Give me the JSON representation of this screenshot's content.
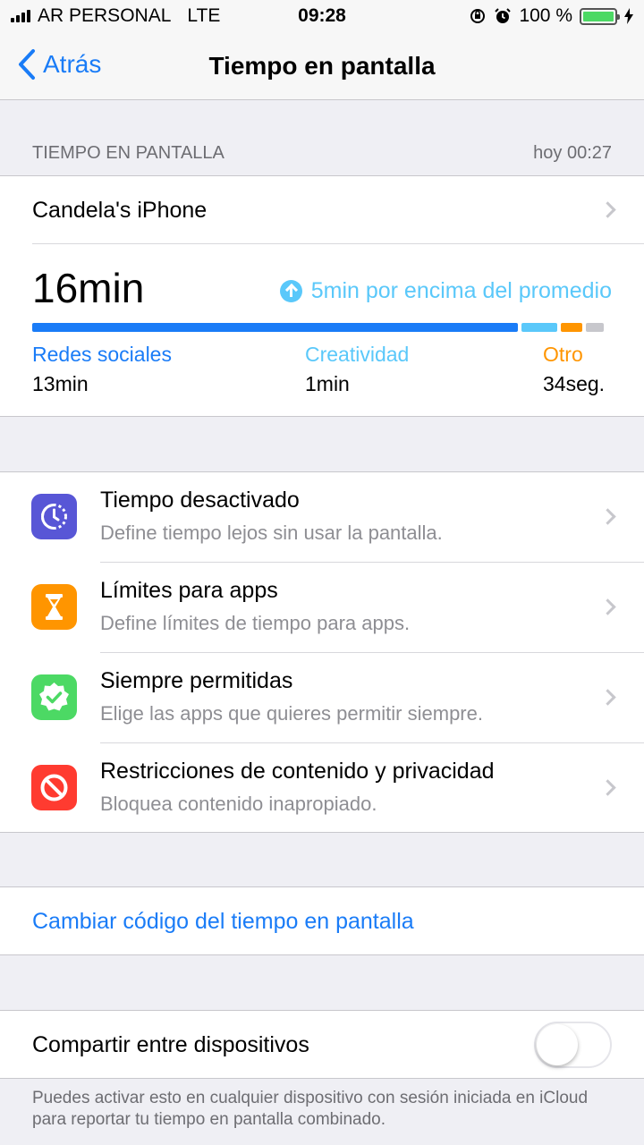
{
  "status_bar": {
    "carrier": "AR PERSONAL",
    "network": "LTE",
    "time": "09:28",
    "battery_percent": "100 %",
    "battery_level": 1.0
  },
  "nav": {
    "back_label": "Atrás",
    "title": "Tiempo en pantalla"
  },
  "section_header": {
    "title": "TIEMPO EN PANTALLA",
    "time": "hoy 00:27"
  },
  "usage": {
    "device_name": "Candela's iPhone",
    "total": "16min",
    "average_note": "5min por encima del promedio",
    "categories": [
      {
        "label": "Redes sociales",
        "value": "13min",
        "color": "#1a7cf7"
      },
      {
        "label": "Creatividad",
        "value": "1min",
        "color": "#5ac8fa"
      },
      {
        "label": "Otro",
        "value": "34seg.",
        "color": "#ff9500"
      }
    ],
    "bar_share": {
      "social": 0.853,
      "creative": 0.064,
      "other": 0.037,
      "rest": 0.032
    }
  },
  "features": [
    {
      "title": "Tiempo desactivado",
      "subtitle": "Define tiempo lejos sin usar la pantalla.",
      "icon": "downtime-icon",
      "color": "#5856d6"
    },
    {
      "title": "Límites para apps",
      "subtitle": "Define límites de tiempo para apps.",
      "icon": "hourglass-icon",
      "color": "#ff9500"
    },
    {
      "title": "Siempre permitidas",
      "subtitle": "Elige las apps que quieres permitir siempre.",
      "icon": "checkmark-badge-icon",
      "color": "#4cd964"
    },
    {
      "title": "Restricciones de contenido y privacidad",
      "subtitle": "Bloquea contenido inapropiado.",
      "icon": "no-entry-icon",
      "color": "#ff3b30"
    }
  ],
  "passcode": {
    "label": "Cambiar código del tiempo en pantalla"
  },
  "share": {
    "label": "Compartir entre dispositivos",
    "enabled": false,
    "footer": "Puedes activar esto en cualquier dispositivo con sesión iniciada en iCloud para reportar tu tiempo en pantalla combinado."
  }
}
